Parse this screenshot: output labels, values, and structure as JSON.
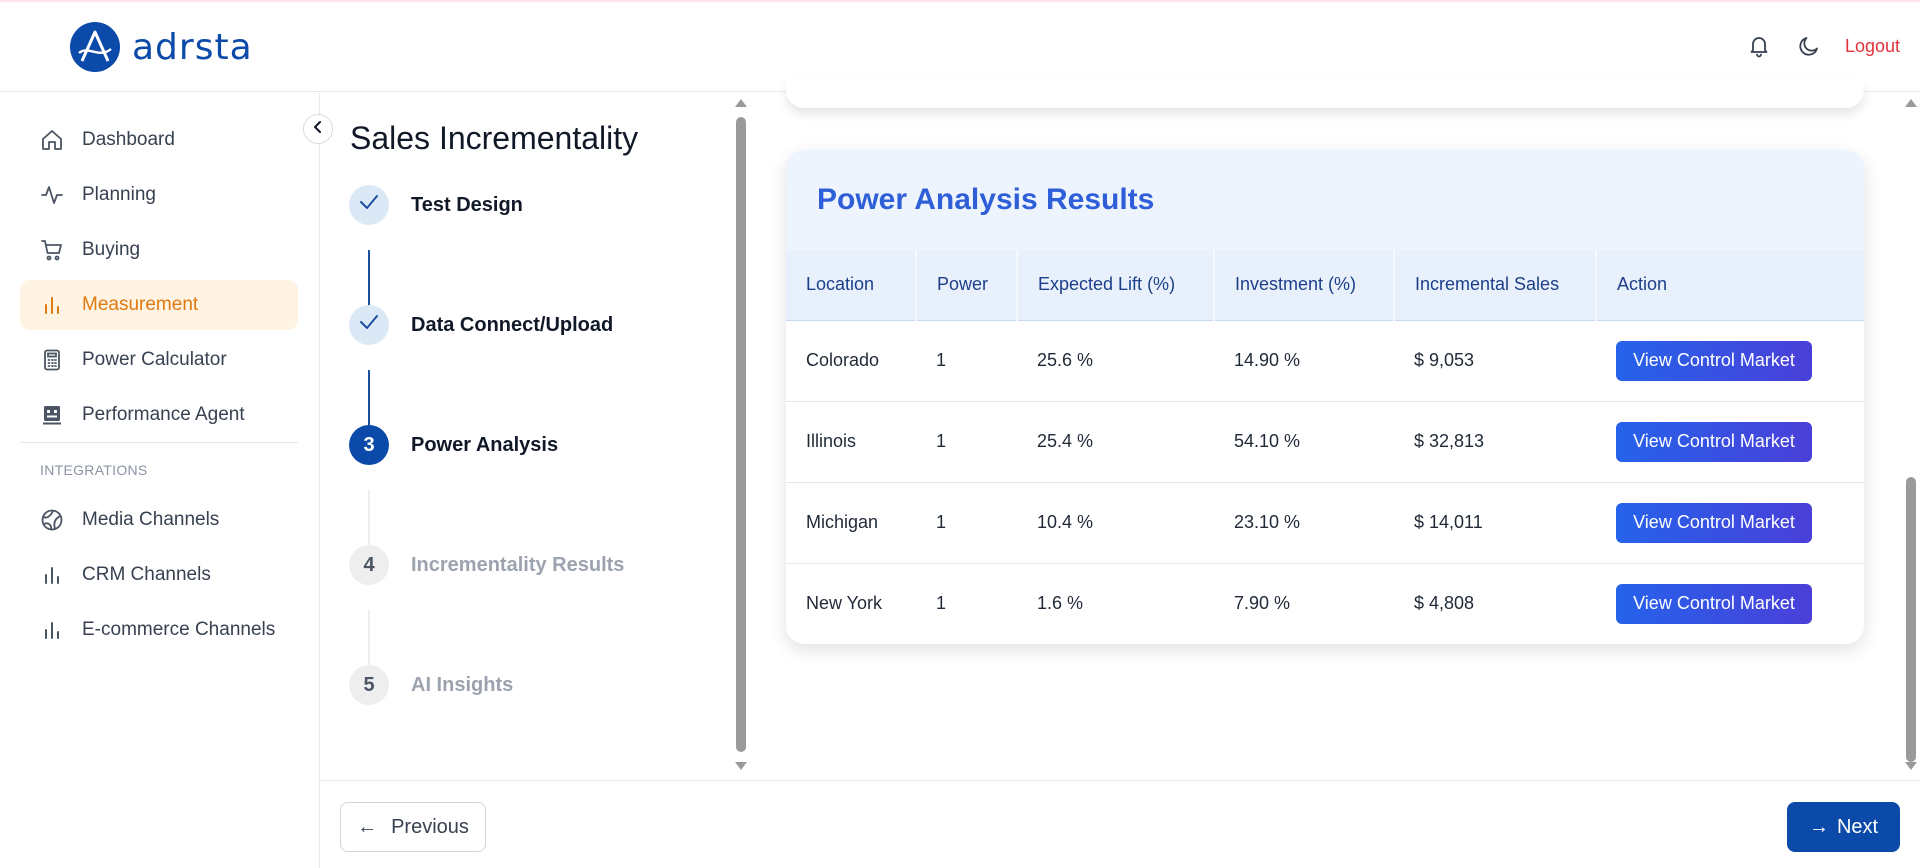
{
  "app": {
    "logo_text": "adrsta"
  },
  "header": {
    "logout_label": "Logout"
  },
  "sidebar": {
    "items": [
      {
        "label": "Dashboard",
        "icon": "home-icon"
      },
      {
        "label": "Planning",
        "icon": "activity-icon"
      },
      {
        "label": "Buying",
        "icon": "cart-icon"
      },
      {
        "label": "Measurement",
        "icon": "bar-chart-icon",
        "active": true
      },
      {
        "label": "Power Calculator",
        "icon": "calculator-icon"
      },
      {
        "label": "Performance Agent",
        "icon": "robot-icon"
      }
    ],
    "section_label": "INTEGRATIONS",
    "integrations": [
      {
        "label": "Media Channels",
        "icon": "globe-icon"
      },
      {
        "label": "CRM Channels",
        "icon": "bar-chart-icon"
      },
      {
        "label": "E-commerce Channels",
        "icon": "bar-chart-icon"
      }
    ]
  },
  "steps": {
    "title": "Sales Incrementality",
    "items": [
      {
        "number": "",
        "label": "Test Design",
        "status": "done"
      },
      {
        "number": "",
        "label": "Data Connect/Upload",
        "status": "done"
      },
      {
        "number": "3",
        "label": "Power Analysis",
        "status": "current"
      },
      {
        "number": "4",
        "label": "Incrementality Results",
        "status": "todo"
      },
      {
        "number": "5",
        "label": "AI Insights",
        "status": "todo"
      }
    ]
  },
  "results": {
    "title": "Power Analysis Results",
    "columns": [
      "Location",
      "Power",
      "Expected Lift (%)",
      "Investment (%)",
      "Incremental Sales",
      "Action"
    ],
    "rows": [
      {
        "location": "Colorado",
        "power": "1",
        "lift": "25.6 %",
        "investment": "14.90 %",
        "sales": "$ 9,053",
        "action": "View Control Market"
      },
      {
        "location": "Illinois",
        "power": "1",
        "lift": "25.4 %",
        "investment": "54.10 %",
        "sales": "$ 32,813",
        "action": "View Control Market"
      },
      {
        "location": "Michigan",
        "power": "1",
        "lift": "10.4 %",
        "investment": "23.10 %",
        "sales": "$ 14,011",
        "action": "View Control Market"
      },
      {
        "location": "New York",
        "power": "1",
        "lift": "1.6 %",
        "investment": "7.90 %",
        "sales": "$ 4,808",
        "action": "View Control Market"
      }
    ]
  },
  "footer": {
    "previous_label": "Previous",
    "previous_arrow": "←",
    "next_label": "Next",
    "next_arrow": "→"
  },
  "colors": {
    "brand": "#0b4aa8",
    "accent": "#e07a0e",
    "results_title": "#2e5fd8",
    "logout": "#e0323c"
  }
}
